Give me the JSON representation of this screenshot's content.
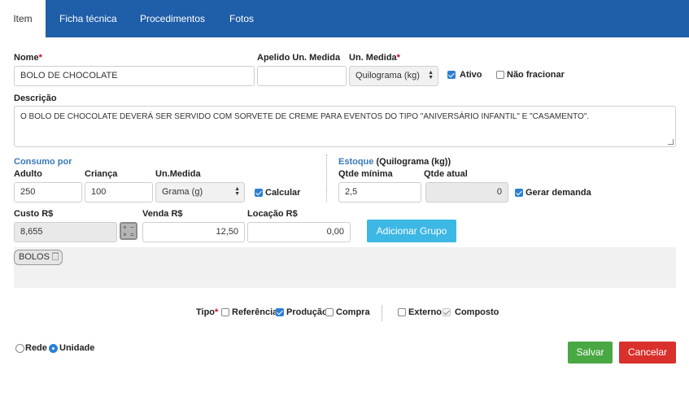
{
  "tabs": [
    "Item",
    "Ficha técnica",
    "Procedimentos",
    "Fotos"
  ],
  "form": {
    "nome_label": "Nome",
    "nome_value": "BOLO DE CHOCOLATE",
    "apelido_label": "Apelido Un. Medida",
    "apelido_value": "",
    "un_medida_label": "Un. Medida",
    "un_medida_value": "Quilograma (kg)",
    "ativo_label": "Ativo",
    "nao_fracionar_label": "Não fracionar",
    "descricao_label": "Descrição",
    "descricao_value": "O BOLO DE CHOCOLATE DEVERÁ SER SERVIDO COM SORVETE DE CREME PARA EVENTOS DO TIPO \"ANIVERSÁRIO INFANTIL\" E \"CASAMENTO\"."
  },
  "consumo": {
    "title": "Consumo por",
    "adulto_label": "Adulto",
    "adulto_value": "250",
    "crianca_label": "Criança",
    "crianca_value": "100",
    "unmedida_label": "Un.Medida",
    "unmedida_value": "Grama (g)",
    "calcular_label": "Calcular"
  },
  "estoque": {
    "title": "Estoque",
    "unit": "(Quilograma (kg))",
    "qtde_minima_label": "Qtde mínima",
    "qtde_minima_value": "2,5",
    "qtde_atual_label": "Qtde atual",
    "qtde_atual_value": "0",
    "gerar_demanda_label": "Gerar demanda"
  },
  "precos": {
    "custo_label": "Custo R$",
    "custo_value": "8,655",
    "venda_label": "Venda R$",
    "venda_value": "12,50",
    "locacao_label": "Locação R$",
    "locacao_value": "0,00",
    "adicionar_grupo_label": "Adicionar Grupo"
  },
  "groups": [
    "BOLOS"
  ],
  "tipo": {
    "label": "Tipo",
    "referencia": "Referência",
    "producao": "Produção",
    "compra": "Compra",
    "externo": "Externo",
    "composto": "Composto"
  },
  "scope": {
    "rede": "Rede",
    "unidade": "Unidade"
  },
  "actions": {
    "salvar": "Salvar",
    "cancelar": "Cancelar"
  },
  "colors": {
    "tab_bar": "#1f5ea8",
    "add_group": "#3db7e4",
    "salvar": "#4aa843",
    "cancelar": "#d9302c",
    "checkbox": "#2d7fd2"
  }
}
